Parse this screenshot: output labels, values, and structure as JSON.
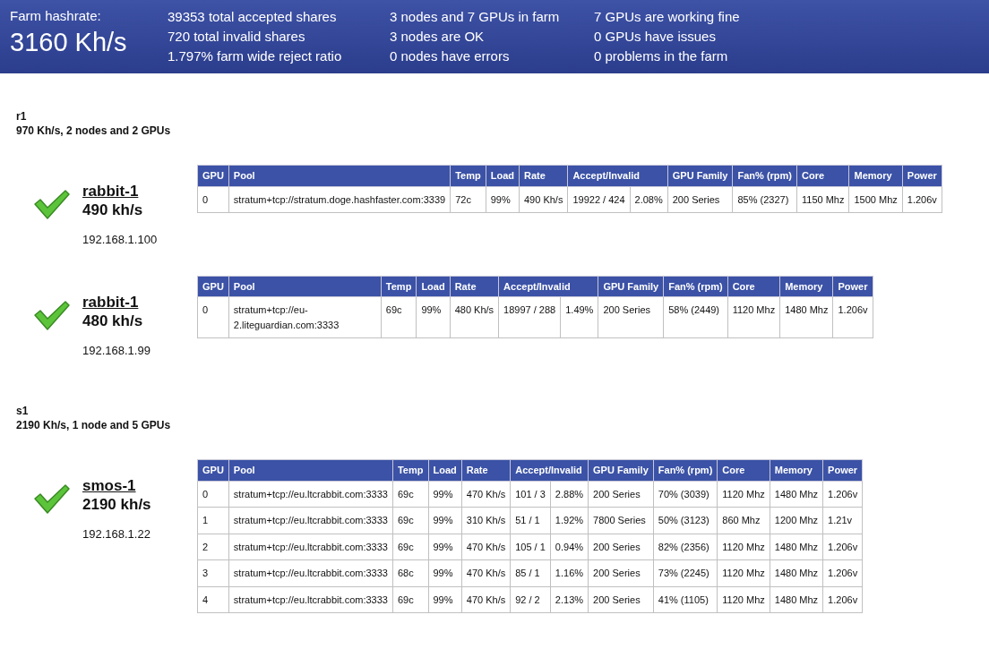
{
  "header": {
    "label": "Farm hashrate:",
    "value": "3160 Kh/s",
    "stats": [
      [
        "39353 total accepted shares",
        "720 total invalid shares",
        "1.797% farm wide reject ratio"
      ],
      [
        "3 nodes and 7 GPUs in farm",
        "3 nodes are OK",
        "0 nodes have errors"
      ],
      [
        "7 GPUs are working fine",
        "0 GPUs have issues",
        "0 problems in the farm"
      ]
    ]
  },
  "groups": [
    {
      "name": "r1",
      "summary": "970 Kh/s, 2 nodes and 2 GPUs",
      "nodes": [
        {
          "name": "rabbit-1",
          "hashrate": "490 kh/s",
          "ip": "192.168.1.100",
          "ok": true,
          "columns": [
            {
              "label": "GPU"
            },
            {
              "label": "Pool"
            },
            {
              "label": "Temp"
            },
            {
              "label": "Load"
            },
            {
              "label": "Rate"
            },
            {
              "label": "Accept/Invalid",
              "colspan": 2
            },
            {
              "label": "GPU Family"
            },
            {
              "label": "Fan% (rpm)"
            },
            {
              "label": "Core"
            },
            {
              "label": "Memory"
            },
            {
              "label": "Power"
            }
          ],
          "rows": [
            [
              "0",
              "stratum+tcp://stratum.doge.hashfaster.com:3339",
              "72c",
              "99%",
              "490 Kh/s",
              "19922 / 424",
              "2.08%",
              "200 Series",
              "85% (2327)",
              "1150 Mhz",
              "1500 Mhz",
              "1.206v"
            ]
          ]
        },
        {
          "name": "rabbit-1",
          "hashrate": "480 kh/s",
          "ip": "192.168.1.99",
          "ok": true,
          "columns": [
            {
              "label": "GPU"
            },
            {
              "label": "Pool"
            },
            {
              "label": "Temp"
            },
            {
              "label": "Load"
            },
            {
              "label": "Rate"
            },
            {
              "label": "Accept/Invalid",
              "colspan": 2
            },
            {
              "label": "GPU Family"
            },
            {
              "label": "Fan% (rpm)"
            },
            {
              "label": "Core"
            },
            {
              "label": "Memory"
            },
            {
              "label": "Power"
            }
          ],
          "rows": [
            [
              "0",
              "stratum+tcp://eu-2.liteguardian.com:3333",
              "69c",
              "99%",
              "480 Kh/s",
              "18997 / 288",
              "1.49%",
              "200 Series",
              "58% (2449)",
              "1120 Mhz",
              "1480 Mhz",
              "1.206v"
            ]
          ]
        }
      ]
    },
    {
      "name": "s1",
      "summary": "2190 Kh/s, 1 node and 5 GPUs",
      "nodes": [
        {
          "name": "smos-1",
          "hashrate": "2190 kh/s",
          "ip": "192.168.1.22",
          "ok": true,
          "columns": [
            {
              "label": "GPU"
            },
            {
              "label": "Pool"
            },
            {
              "label": "Temp"
            },
            {
              "label": "Load"
            },
            {
              "label": "Rate"
            },
            {
              "label": "Accept/Invalid",
              "colspan": 2
            },
            {
              "label": "GPU Family"
            },
            {
              "label": "Fan% (rpm)"
            },
            {
              "label": "Core"
            },
            {
              "label": "Memory"
            },
            {
              "label": "Power"
            }
          ],
          "rows": [
            [
              "0",
              "stratum+tcp://eu.ltcrabbit.com:3333",
              "69c",
              "99%",
              "470 Kh/s",
              "101 / 3",
              "2.88%",
              "200 Series",
              "70% (3039)",
              "1120 Mhz",
              "1480 Mhz",
              "1.206v"
            ],
            [
              "1",
              "stratum+tcp://eu.ltcrabbit.com:3333",
              "69c",
              "99%",
              "310 Kh/s",
              "51 / 1",
              "1.92%",
              "7800 Series",
              "50% (3123)",
              "860 Mhz",
              "1200 Mhz",
              "1.21v"
            ],
            [
              "2",
              "stratum+tcp://eu.ltcrabbit.com:3333",
              "69c",
              "99%",
              "470 Kh/s",
              "105 / 1",
              "0.94%",
              "200 Series",
              "82% (2356)",
              "1120 Mhz",
              "1480 Mhz",
              "1.206v"
            ],
            [
              "3",
              "stratum+tcp://eu.ltcrabbit.com:3333",
              "68c",
              "99%",
              "470 Kh/s",
              "85 / 1",
              "1.16%",
              "200 Series",
              "73% (2245)",
              "1120 Mhz",
              "1480 Mhz",
              "1.206v"
            ],
            [
              "4",
              "stratum+tcp://eu.ltcrabbit.com:3333",
              "69c",
              "99%",
              "470 Kh/s",
              "92 / 2",
              "2.13%",
              "200 Series",
              "41% (1105)",
              "1120 Mhz",
              "1480 Mhz",
              "1.206v"
            ]
          ]
        }
      ]
    }
  ]
}
